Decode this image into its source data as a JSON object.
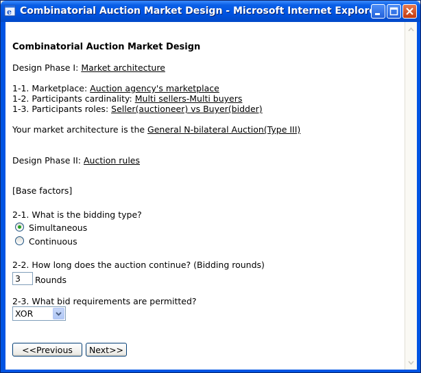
{
  "window": {
    "title": "Combinatorial Auction Market Design - Microsoft Internet Explorer"
  },
  "page": {
    "heading": "Combinatorial Auction Market Design",
    "phase1": {
      "prefix": "Design Phase I: ",
      "link": "Market architecture",
      "items": [
        {
          "prefix": "1-1. Marketplace: ",
          "link": "Auction agency's marketplace"
        },
        {
          "prefix": "1-2. Participants cardinality: ",
          "link": "Multi sellers-Multi buyers"
        },
        {
          "prefix": "1-3. Participants roles: ",
          "link": "Seller(auctioneer) vs Buyer(bidder)"
        }
      ],
      "summary_prefix": "Your market architecture is the ",
      "summary_link": "General N-bilateral Auction(Type III)"
    },
    "phase2": {
      "prefix": "Design Phase II: ",
      "link": "Auction rules",
      "base_factors": "[Base factors]",
      "q1": {
        "label": "2-1. What is the bidding type?",
        "options": [
          {
            "label": "Simultaneous",
            "selected": true
          },
          {
            "label": "Continuous",
            "selected": false
          }
        ]
      },
      "q2": {
        "label": "2-2. How long does the auction continue? (Bidding rounds)",
        "value": "3",
        "unit": "Rounds"
      },
      "q3": {
        "label": "2-3. What bid requirements are permitted?",
        "selected": "XOR"
      }
    },
    "buttons": {
      "previous": "<<Previous",
      "next": "Next>>"
    }
  }
}
